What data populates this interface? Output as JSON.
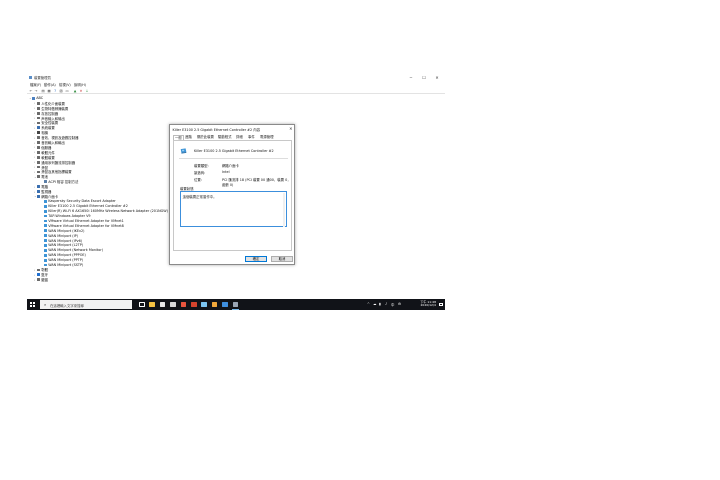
{
  "window": {
    "title": "裝置管理員",
    "controls": {
      "minimize": "─",
      "maximize": "☐",
      "close": "✕"
    }
  },
  "menu": [
    "檔案(F)",
    "動作(A)",
    "檢視(V)",
    "說明(H)"
  ],
  "toolbar": {
    "buttons": [
      {
        "icon": "back-icon",
        "glyph": "←"
      },
      {
        "icon": "forward-icon",
        "glyph": "→"
      },
      {
        "icon": "show-hide-tree-icon",
        "glyph": "▤"
      },
      {
        "icon": "properties-icon",
        "glyph": "▦"
      },
      {
        "icon": "help-icon",
        "glyph": "?"
      },
      {
        "icon": "view-icon",
        "glyph": "▧"
      },
      {
        "icon": "monitor-icon",
        "glyph": "▭"
      },
      {
        "icon": "update-driver-icon",
        "glyph": "▲"
      },
      {
        "icon": "remove-device-icon",
        "glyph": "✕"
      },
      {
        "icon": "scan-hardware-icon",
        "glyph": "↓"
      }
    ]
  },
  "tree": {
    "root": "ABC",
    "categories": [
      {
        "label": "人性化介面裝置",
        "color": "#6b6b6b"
      },
      {
        "label": "生物特徵辨識裝置",
        "color": "#6b6b6b"
      },
      {
        "label": "存放控制器",
        "color": "#6b6b6b"
      },
      {
        "label": "声音输入和输出",
        "color": "#6b6b6b"
      },
      {
        "label": "安全性裝置",
        "color": "#6b6b6b"
      },
      {
        "label": "系統裝置",
        "color": "#3a6fb0"
      },
      {
        "label": "相機",
        "color": "#444444"
      },
      {
        "label": "音效、視訊及遊戲控制器",
        "color": "#6b6b6b"
      },
      {
        "label": "音訊輸入和輸出",
        "color": "#6b6b6b"
      },
      {
        "label": "個服器",
        "color": "#6b6b6b"
      },
      {
        "label": "軟體元件",
        "color": "#6b6b6b"
      },
      {
        "label": "軟體裝置",
        "color": "#6b6b6b"
      },
      {
        "label": "通用序列匯流排控制器",
        "color": "#6b6b6b"
      },
      {
        "label": "滑鼠",
        "color": "#6b6b6b"
      },
      {
        "label": "滑鼠及其他指標裝置",
        "color": "#6b6b6b"
      },
      {
        "label": "電池",
        "color": "#6b6b6b"
      }
    ],
    "battery_child": "ACPI 相容 控制方法",
    "after_battery": [
      {
        "label": "電腦",
        "color": "#3a6fb0"
      },
      {
        "label": "監視器",
        "color": "#3a6fb0"
      }
    ],
    "network_category": "網路介面卡",
    "network_adapters": [
      "Kaspersky Security Data Escort Adapter",
      "Killer E3100 2.5 Gigabit Ethernet Controller #2",
      "Killer(R) Wi-Fi 6 AX1650i 160MHz Wireless Network Adapter (201NGW)",
      "TAP-Windows Adapter V9",
      "VMware Virtual Ethernet Adapter for VMnet1",
      "VMware Virtual Ethernet Adapter for VMnet8",
      "WAN Miniport (IKEv2)",
      "WAN Miniport (IP)",
      "WAN Miniport (IPv6)",
      "WAN Miniport (L2TP)",
      "WAN Miniport (Network Monitor)",
      "WAN Miniport (PPPOE)",
      "WAN Miniport (PPTP)",
      "WAN Miniport (SSTP)"
    ],
    "tail": [
      {
        "label": "韌體",
        "color": "#6b6b6b"
      },
      {
        "label": "藍牙",
        "color": "#1f6fd1"
      },
      {
        "label": "鍵盤",
        "color": "#6b6b6b"
      }
    ]
  },
  "dialog": {
    "title": "Killer E3100 2.5 Gigabit Ethernet Controller #2 內容",
    "close": "✕",
    "tabs": [
      "一般",
      "進階",
      "關於此裝置",
      "驅動程式",
      "詳細",
      "事件",
      "電源管理"
    ],
    "device_name": "Killer E3100 2.5 Gigabit Ethernet Controller #2",
    "properties": [
      {
        "label": "裝置類型:",
        "value": "網路介面卡"
      },
      {
        "label": "製造商:",
        "value": "Intel"
      },
      {
        "label": "位置:",
        "value": "PCI 匯流排 18 (PCI 裝置 00 通00，裝置 0，函數 0)"
      }
    ],
    "status_label": "裝置狀態",
    "status_text": "這個裝置正常運作中。",
    "ok": "確定",
    "cancel": "取消"
  },
  "taskbar": {
    "search_placeholder": "在這裡輸入文字來搜尋",
    "pinned": [
      {
        "icon": "task-view-icon",
        "color": "#ffffff"
      },
      {
        "icon": "file-explorer-icon",
        "color": "#f6c343"
      },
      {
        "icon": "store-icon",
        "color": "#e8e8e8"
      },
      {
        "icon": "mail-icon",
        "color": "#d9d9d9"
      },
      {
        "icon": "browser-icon",
        "color": "#e8553e"
      },
      {
        "icon": "media-player-icon",
        "color": "#d6442d"
      },
      {
        "icon": "app-icon",
        "color": "#7cc5f2"
      },
      {
        "icon": "file-manager-icon",
        "color": "#f2a83b"
      },
      {
        "icon": "settings-window-icon",
        "color": "#3f8fde"
      },
      {
        "icon": "device-manager-icon",
        "color": "#9aa6b5"
      }
    ],
    "tray_icons": [
      "^",
      "☁",
      "▮",
      "♪",
      "中",
      "⚙"
    ],
    "time": "下午 11:48",
    "date": "2020/12/4"
  }
}
